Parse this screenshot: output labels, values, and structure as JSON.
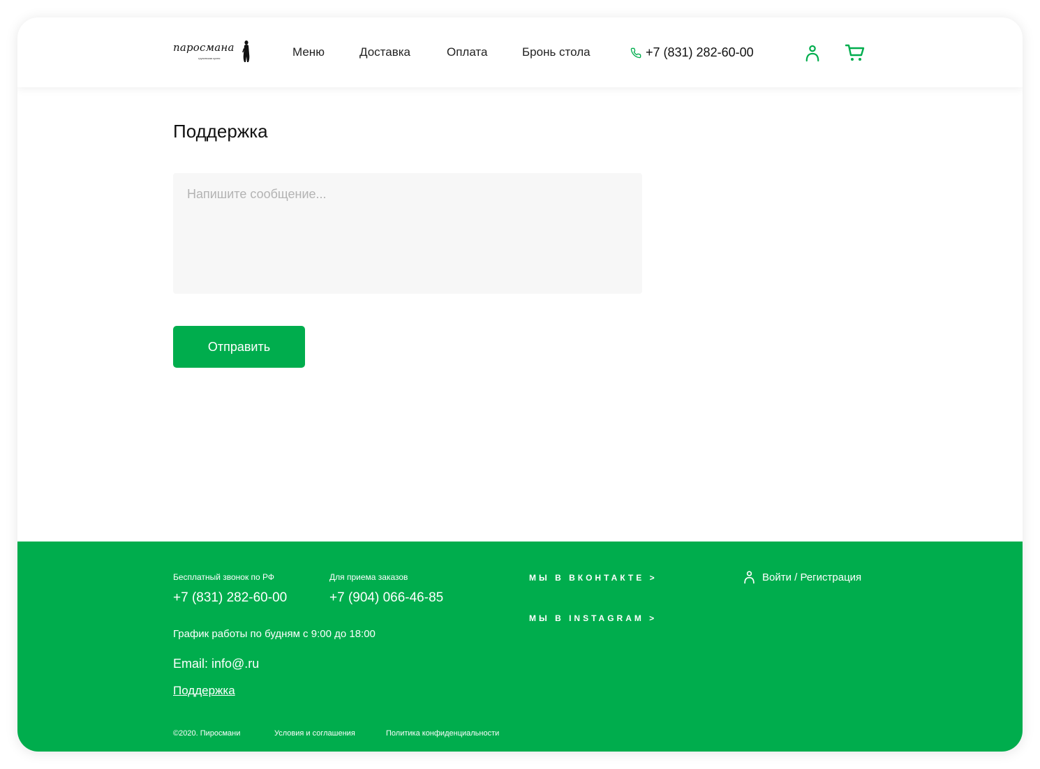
{
  "brand": {
    "logo_text": "паросмана",
    "logo_subtext": "грузинская кухня"
  },
  "nav": {
    "items": [
      {
        "label": "Меню"
      },
      {
        "label": "Доставка"
      },
      {
        "label": "Оплата"
      },
      {
        "label": "Бронь стола"
      }
    ],
    "phone": "+7 (831) 282-60-00",
    "phone_icon": "phone-icon",
    "user_icon": "user-icon",
    "cart_icon": "cart-icon"
  },
  "main": {
    "title": "Поддержка",
    "message_placeholder": "Напишите сообщение...",
    "message_value": "",
    "submit_label": "Отправить"
  },
  "footer": {
    "free_call_label": "Бесплатный звонок по РФ",
    "free_call_phone": "+7 (831) 282-60-00",
    "orders_label": "Для приема заказов",
    "orders_phone": "+7 (904) 066-46-85",
    "schedule": "График работы по будням с 9:00 до 18:00",
    "email": "Email: info@.ru",
    "support_link": "Поддержка",
    "vk_link": "МЫ В ВКОНТАКТЕ >",
    "instagram_link": "МЫ В INSTAGRAM >",
    "login_link": "Войти / Регистрация",
    "copyright": "©2020. Пиросмани",
    "terms_link": "Условия и соглашения",
    "privacy_link": "Политика конфиденциальности"
  },
  "colors": {
    "accent": "#00ad4d",
    "input_bg": "#f7f7f7",
    "text": "#111111",
    "placeholder": "#b3b3b3"
  }
}
